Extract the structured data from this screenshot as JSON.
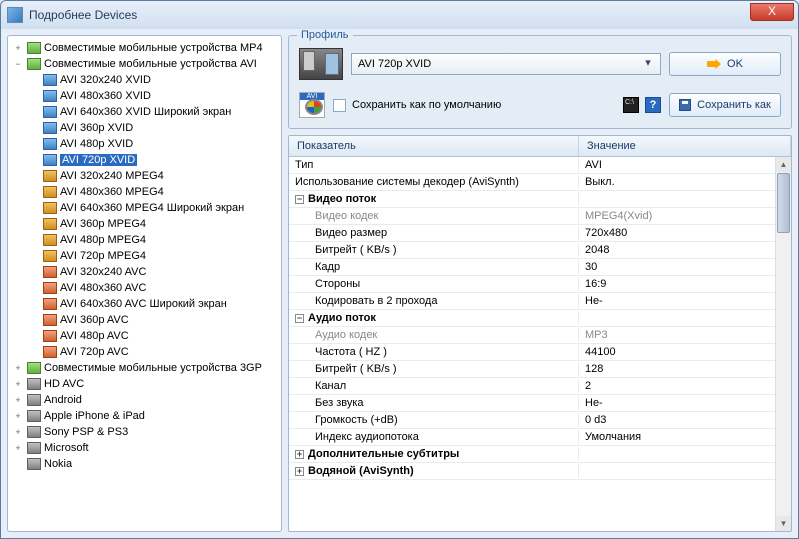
{
  "window": {
    "title": "Подробнее Devices",
    "close": "X"
  },
  "tree": {
    "groups": [
      {
        "label": "Совместимые мобильные устройства MP4",
        "exp": "+",
        "icon": "folder"
      },
      {
        "label": "Совместимые мобильные устройства AVI",
        "exp": "−",
        "icon": "folder",
        "children": [
          {
            "label": "AVI 320x240 XVID",
            "icon": "video"
          },
          {
            "label": "AVI 480x360 XVID",
            "icon": "video"
          },
          {
            "label": "AVI 640x360 XVID Широкий экран",
            "icon": "video"
          },
          {
            "label": "AVI 360p XVID",
            "icon": "video"
          },
          {
            "label": "AVI 480p XVID",
            "icon": "video"
          },
          {
            "label": "AVI 720p XVID",
            "icon": "video",
            "selected": true
          },
          {
            "label": "AVI 320x240 MPEG4",
            "icon": "video-m"
          },
          {
            "label": "AVI 480x360 MPEG4",
            "icon": "video-m"
          },
          {
            "label": "AVI 640x360 MPEG4 Широкий экран",
            "icon": "video-m"
          },
          {
            "label": "AVI 360p MPEG4",
            "icon": "video-m"
          },
          {
            "label": "AVI 480p MPEG4",
            "icon": "video-m"
          },
          {
            "label": "AVI 720p MPEG4",
            "icon": "video-m"
          },
          {
            "label": "AVI 320x240 AVC",
            "icon": "video-a"
          },
          {
            "label": "AVI 480x360 AVC",
            "icon": "video-a"
          },
          {
            "label": "AVI 640x360 AVC Широкий экран",
            "icon": "video-a"
          },
          {
            "label": "AVI 360p AVC",
            "icon": "video-a"
          },
          {
            "label": "AVI 480p AVC",
            "icon": "video-a"
          },
          {
            "label": "AVI 720p AVC",
            "icon": "video-a"
          }
        ]
      },
      {
        "label": "Совместимые мобильные устройства 3GP",
        "exp": "+",
        "icon": "folder"
      },
      {
        "label": "HD AVC",
        "exp": "+",
        "icon": "dev"
      },
      {
        "label": "Android",
        "exp": "+",
        "icon": "dev"
      },
      {
        "label": "Apple iPhone & iPad",
        "exp": "+",
        "icon": "dev"
      },
      {
        "label": "Sony PSP & PS3",
        "exp": "+",
        "icon": "dev"
      },
      {
        "label": "Microsoft",
        "exp": "+",
        "icon": "dev"
      },
      {
        "label": "Nokia",
        "exp": "",
        "icon": "dev"
      }
    ]
  },
  "profile": {
    "legend": "Профиль",
    "selected": "AVI 720p XVID",
    "ok": "OK",
    "saveAsDefault": "Сохранить как по умолчанию",
    "saveAs": "Сохранить как"
  },
  "table": {
    "col1": "Показатель",
    "col2": "Значение",
    "rows": [
      {
        "k": "Тип",
        "v": "AVI"
      },
      {
        "k": "Использование системы декодер (AviSynth)",
        "v": "Выкл."
      },
      {
        "k": "Видео поток",
        "group": true,
        "exp": "−"
      },
      {
        "k": "Видео кодек",
        "v": "MPEG4(Xvid)",
        "sub": true,
        "gray": true
      },
      {
        "k": "Видео размер",
        "v": "720x480",
        "sub": true
      },
      {
        "k": "Битрейт ( KB/s )",
        "v": "2048",
        "sub": true
      },
      {
        "k": "Кадр",
        "v": "30",
        "sub": true
      },
      {
        "k": "Стороны",
        "v": "16:9",
        "sub": true
      },
      {
        "k": "Кодировать в 2 прохода",
        "v": "Не-",
        "sub": true
      },
      {
        "k": "Аудио поток",
        "group": true,
        "exp": "−"
      },
      {
        "k": "Аудио кодек",
        "v": "MP3",
        "sub": true,
        "gray": true
      },
      {
        "k": "Частота ( HZ )",
        "v": "44100",
        "sub": true
      },
      {
        "k": "Битрейт ( KB/s )",
        "v": "128",
        "sub": true
      },
      {
        "k": "Канал",
        "v": "2",
        "sub": true
      },
      {
        "k": "Без звука",
        "v": "Не-",
        "sub": true
      },
      {
        "k": "Громкость (+dB)",
        "v": "0 d3",
        "sub": true
      },
      {
        "k": "Индекс аудиопотока",
        "v": "Умолчания",
        "sub": true
      },
      {
        "k": "Дополнительные субтитры",
        "group": true,
        "exp": "+"
      },
      {
        "k": "Водяной (AviSynth)",
        "group": true,
        "exp": "+",
        "cut": true
      }
    ]
  }
}
